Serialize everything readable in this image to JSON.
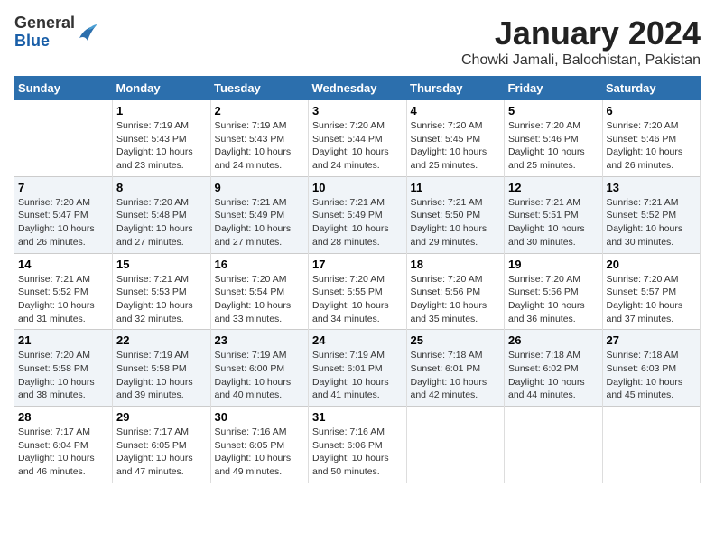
{
  "logo": {
    "general": "General",
    "blue": "Blue"
  },
  "title": "January 2024",
  "location": "Chowki Jamali, Balochistan, Pakistan",
  "days_of_week": [
    "Sunday",
    "Monday",
    "Tuesday",
    "Wednesday",
    "Thursday",
    "Friday",
    "Saturday"
  ],
  "weeks": [
    [
      {
        "day": "",
        "info": ""
      },
      {
        "day": "1",
        "info": "Sunrise: 7:19 AM\nSunset: 5:43 PM\nDaylight: 10 hours and 23 minutes."
      },
      {
        "day": "2",
        "info": "Sunrise: 7:19 AM\nSunset: 5:43 PM\nDaylight: 10 hours and 24 minutes."
      },
      {
        "day": "3",
        "info": "Sunrise: 7:20 AM\nSunset: 5:44 PM\nDaylight: 10 hours and 24 minutes."
      },
      {
        "day": "4",
        "info": "Sunrise: 7:20 AM\nSunset: 5:45 PM\nDaylight: 10 hours and 25 minutes."
      },
      {
        "day": "5",
        "info": "Sunrise: 7:20 AM\nSunset: 5:46 PM\nDaylight: 10 hours and 25 minutes."
      },
      {
        "day": "6",
        "info": "Sunrise: 7:20 AM\nSunset: 5:46 PM\nDaylight: 10 hours and 26 minutes."
      }
    ],
    [
      {
        "day": "7",
        "info": "Sunrise: 7:20 AM\nSunset: 5:47 PM\nDaylight: 10 hours and 26 minutes."
      },
      {
        "day": "8",
        "info": "Sunrise: 7:20 AM\nSunset: 5:48 PM\nDaylight: 10 hours and 27 minutes."
      },
      {
        "day": "9",
        "info": "Sunrise: 7:21 AM\nSunset: 5:49 PM\nDaylight: 10 hours and 27 minutes."
      },
      {
        "day": "10",
        "info": "Sunrise: 7:21 AM\nSunset: 5:49 PM\nDaylight: 10 hours and 28 minutes."
      },
      {
        "day": "11",
        "info": "Sunrise: 7:21 AM\nSunset: 5:50 PM\nDaylight: 10 hours and 29 minutes."
      },
      {
        "day": "12",
        "info": "Sunrise: 7:21 AM\nSunset: 5:51 PM\nDaylight: 10 hours and 30 minutes."
      },
      {
        "day": "13",
        "info": "Sunrise: 7:21 AM\nSunset: 5:52 PM\nDaylight: 10 hours and 30 minutes."
      }
    ],
    [
      {
        "day": "14",
        "info": "Sunrise: 7:21 AM\nSunset: 5:52 PM\nDaylight: 10 hours and 31 minutes."
      },
      {
        "day": "15",
        "info": "Sunrise: 7:21 AM\nSunset: 5:53 PM\nDaylight: 10 hours and 32 minutes."
      },
      {
        "day": "16",
        "info": "Sunrise: 7:20 AM\nSunset: 5:54 PM\nDaylight: 10 hours and 33 minutes."
      },
      {
        "day": "17",
        "info": "Sunrise: 7:20 AM\nSunset: 5:55 PM\nDaylight: 10 hours and 34 minutes."
      },
      {
        "day": "18",
        "info": "Sunrise: 7:20 AM\nSunset: 5:56 PM\nDaylight: 10 hours and 35 minutes."
      },
      {
        "day": "19",
        "info": "Sunrise: 7:20 AM\nSunset: 5:56 PM\nDaylight: 10 hours and 36 minutes."
      },
      {
        "day": "20",
        "info": "Sunrise: 7:20 AM\nSunset: 5:57 PM\nDaylight: 10 hours and 37 minutes."
      }
    ],
    [
      {
        "day": "21",
        "info": "Sunrise: 7:20 AM\nSunset: 5:58 PM\nDaylight: 10 hours and 38 minutes."
      },
      {
        "day": "22",
        "info": "Sunrise: 7:19 AM\nSunset: 5:58 PM\nDaylight: 10 hours and 39 minutes."
      },
      {
        "day": "23",
        "info": "Sunrise: 7:19 AM\nSunset: 6:00 PM\nDaylight: 10 hours and 40 minutes."
      },
      {
        "day": "24",
        "info": "Sunrise: 7:19 AM\nSunset: 6:01 PM\nDaylight: 10 hours and 41 minutes."
      },
      {
        "day": "25",
        "info": "Sunrise: 7:18 AM\nSunset: 6:01 PM\nDaylight: 10 hours and 42 minutes."
      },
      {
        "day": "26",
        "info": "Sunrise: 7:18 AM\nSunset: 6:02 PM\nDaylight: 10 hours and 44 minutes."
      },
      {
        "day": "27",
        "info": "Sunrise: 7:18 AM\nSunset: 6:03 PM\nDaylight: 10 hours and 45 minutes."
      }
    ],
    [
      {
        "day": "28",
        "info": "Sunrise: 7:17 AM\nSunset: 6:04 PM\nDaylight: 10 hours and 46 minutes."
      },
      {
        "day": "29",
        "info": "Sunrise: 7:17 AM\nSunset: 6:05 PM\nDaylight: 10 hours and 47 minutes."
      },
      {
        "day": "30",
        "info": "Sunrise: 7:16 AM\nSunset: 6:05 PM\nDaylight: 10 hours and 49 minutes."
      },
      {
        "day": "31",
        "info": "Sunrise: 7:16 AM\nSunset: 6:06 PM\nDaylight: 10 hours and 50 minutes."
      },
      {
        "day": "",
        "info": ""
      },
      {
        "day": "",
        "info": ""
      },
      {
        "day": "",
        "info": ""
      }
    ]
  ]
}
